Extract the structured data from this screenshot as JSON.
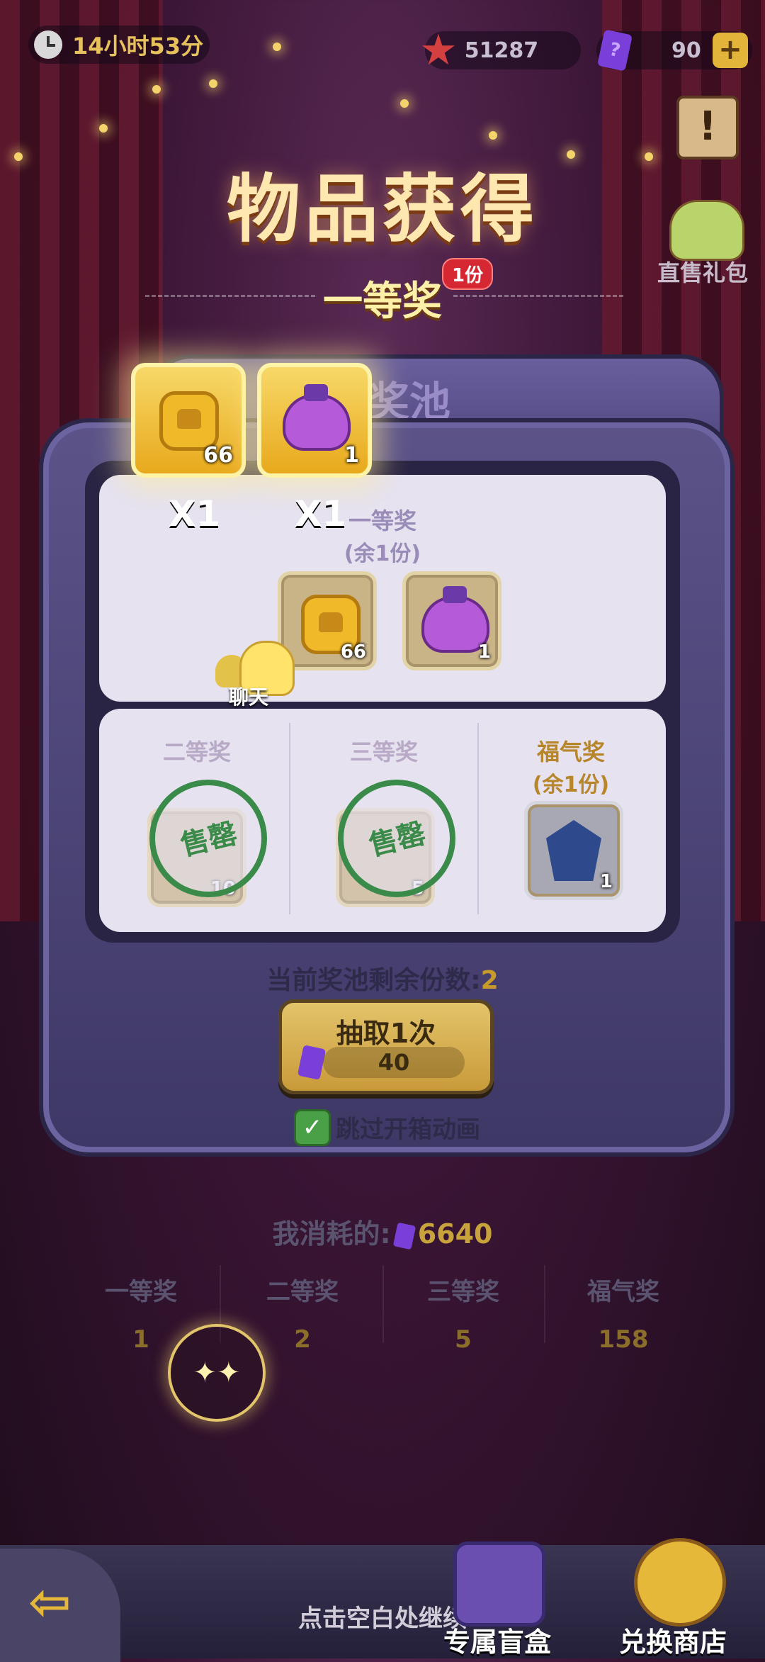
{
  "top_bar": {
    "timer": "14小时53分",
    "stars": "51287",
    "tickets": "90",
    "plus": "+"
  },
  "side": {
    "notice_icon": "!",
    "gift_label": "直售礼包"
  },
  "popup": {
    "title": "物品获得",
    "prize_tier": "一等奖",
    "badge": "1份",
    "items": [
      {
        "icon": "gold-coin",
        "count": "66",
        "multiplier": "X1"
      },
      {
        "icon": "purple-bag",
        "count": "1",
        "multiplier": "X1"
      }
    ]
  },
  "pool": {
    "title": "奖池",
    "first": {
      "name": "一等奖",
      "remain": "(余1份)",
      "items": [
        {
          "count": "66"
        },
        {
          "count": "1"
        }
      ]
    },
    "second": {
      "name": "二等奖",
      "stamp": "售罄",
      "count": "10"
    },
    "third": {
      "name": "三等奖",
      "stamp": "售罄",
      "count": "5"
    },
    "lucky": {
      "name": "福气奖",
      "remain": "(余1份)",
      "count": "1"
    },
    "remaining_label": "当前奖池剩余份数:",
    "remaining_value": "2"
  },
  "chat": {
    "label": "聊天"
  },
  "draw": {
    "label": "抽取1次",
    "price": "40"
  },
  "skip": {
    "checked": true,
    "label": "跳过开箱动画"
  },
  "stats": {
    "consumed_label": "我消耗的:",
    "consumed_value": "6640",
    "tiers": [
      {
        "name": "一等奖",
        "value": "1"
      },
      {
        "name": "二等奖",
        "value": "2"
      },
      {
        "name": "三等奖",
        "value": "5"
      },
      {
        "name": "福气奖",
        "value": "158"
      }
    ]
  },
  "bottom": {
    "continue": "点击空白处继续",
    "box": "专属盲盒",
    "shop": "兑换商店"
  },
  "colors": {
    "gold": "#e6c15c",
    "accent_red": "#d62832",
    "panel": "#e6e2f0"
  }
}
